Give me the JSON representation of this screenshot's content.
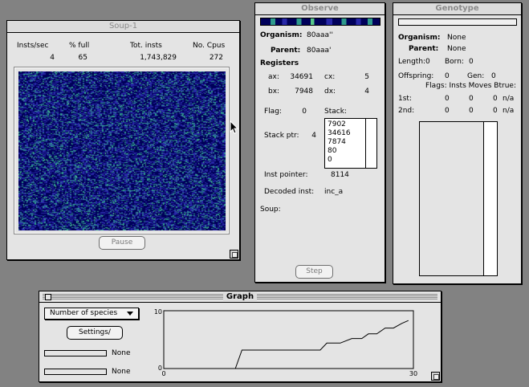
{
  "soup": {
    "title": "Soup-1",
    "headers": [
      "Insts/sec",
      "% full",
      "Tot. insts",
      "No. Cpus"
    ],
    "values": [
      "4",
      "65",
      "1,743,829",
      "272"
    ],
    "pause_label": "Pause"
  },
  "observe": {
    "title": "Observe",
    "organism_label": "Organism:",
    "organism_value": "80aaa''",
    "parent_label": "Parent:",
    "parent_value": "80aaa'",
    "registers_label": "Registers",
    "ax_label": "ax:",
    "ax_value": "34691",
    "cx_label": "cx:",
    "cx_value": "5",
    "bx_label": "bx:",
    "bx_value": "7948",
    "dx_label": "dx:",
    "dx_value": "4",
    "flag_label": "Flag:",
    "flag_value": "0",
    "stack_label": "Stack:",
    "stack_ptr_label": "Stack ptr:",
    "stack_ptr_value": "4",
    "stack": [
      "7902",
      "34616",
      "7874",
      "80",
      "0"
    ],
    "inst_pointer_label": "Inst pointer:",
    "inst_pointer_value": "8114",
    "decoded_label": "Decoded inst:",
    "decoded_value": "inc_a",
    "soup_label": "Soup:",
    "step_label": "Step"
  },
  "genotype": {
    "title": "Genotype",
    "organism_label": "Organism:",
    "organism_value": "None",
    "parent_label": "Parent:",
    "parent_value": "None",
    "length_label": "Length:",
    "length_value": "0",
    "born_label": "Born:",
    "born_value": "0",
    "offspring_label": "Offspring:",
    "offspring_value": "0",
    "gen_label": "Gen:",
    "gen_value": "0",
    "flags_header": "Flags: Insts Moves Btrue:",
    "row1_label": "1st:",
    "row1_values": [
      "0",
      "0",
      "0",
      "n/a"
    ],
    "row2_label": "2nd:",
    "row2_values": [
      "0",
      "0",
      "0",
      "n/a"
    ]
  },
  "graph": {
    "title": "Graph",
    "dropdown_value": "Number of species",
    "settings_label": "Settings/",
    "legend1": "None",
    "legend2": "None"
  },
  "chart_data": {
    "type": "line",
    "xlim": [
      0,
      30
    ],
    "ylim": [
      0,
      10
    ],
    "xticks": [
      "0",
      "30"
    ],
    "yticks": [
      "0",
      "10"
    ],
    "x": [
      0,
      8.6,
      9.4,
      14,
      18.8,
      19.6,
      21.2,
      22.6,
      23.8,
      24.6,
      25.6,
      26.6,
      27.6,
      28.6,
      29.4
    ],
    "y": [
      0,
      0,
      3.2,
      3.2,
      3.2,
      4.4,
      4.4,
      5.2,
      5.2,
      6.0,
      6.0,
      7.0,
      7.0,
      7.8,
      8.3
    ]
  },
  "colors": {
    "desktop": "#828282",
    "window": "#e4e4e4",
    "soup_bg": "#00005a",
    "soup_blue": "#2828a8",
    "soup_green": "#2e9a8c",
    "soup_lightgreen": "#58c88a"
  },
  "icons": [
    "grow-box-icon",
    "close-box-icon",
    "dropdown-arrow-icon",
    "mouse-pointer-icon"
  ]
}
